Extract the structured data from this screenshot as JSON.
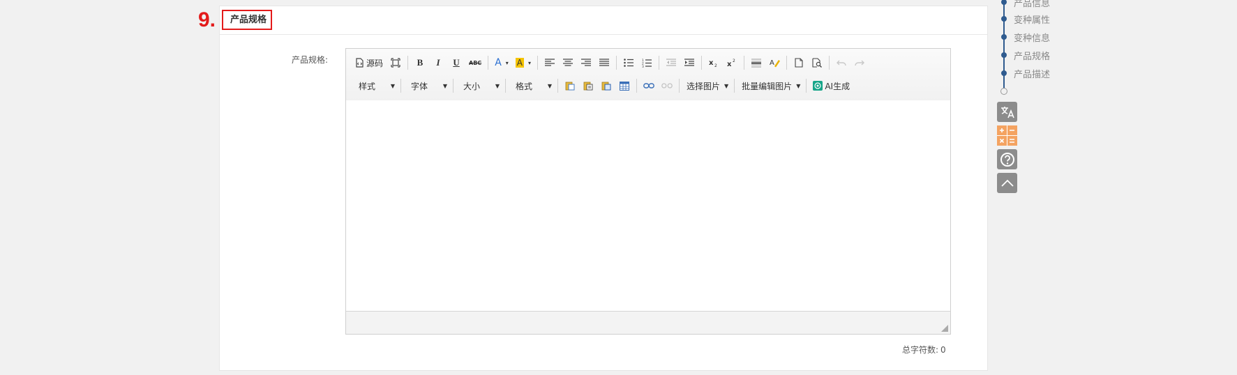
{
  "step_marker": "9.",
  "section": {
    "title": "产品规格",
    "field_label": "产品规格:",
    "char_count_label": "总字符数:",
    "char_count_value": "0"
  },
  "toolbar": {
    "source_label": "源码",
    "style_select": "样式",
    "font_select": "字体",
    "size_select": "大小",
    "format_select": "格式",
    "select_image": "选择图片",
    "batch_edit_image": "批量编辑图片",
    "ai_generate": "AI生成",
    "font_color_glyph": "A",
    "bg_color_glyph": "A",
    "bold_glyph": "B",
    "italic_glyph": "I",
    "underline_glyph": "U",
    "strike_glyph": "ABC",
    "highlight_color": "#f5c400",
    "ai_icon_color": "#17a589"
  },
  "outline_nav": {
    "items": [
      "产品信息",
      "变种属性",
      "变种信息",
      "产品规格",
      "产品描述"
    ],
    "accent": "#2f5b8f"
  },
  "side_tools": {
    "translate_glyph": "文A",
    "calculator_color": "#f4a361"
  }
}
